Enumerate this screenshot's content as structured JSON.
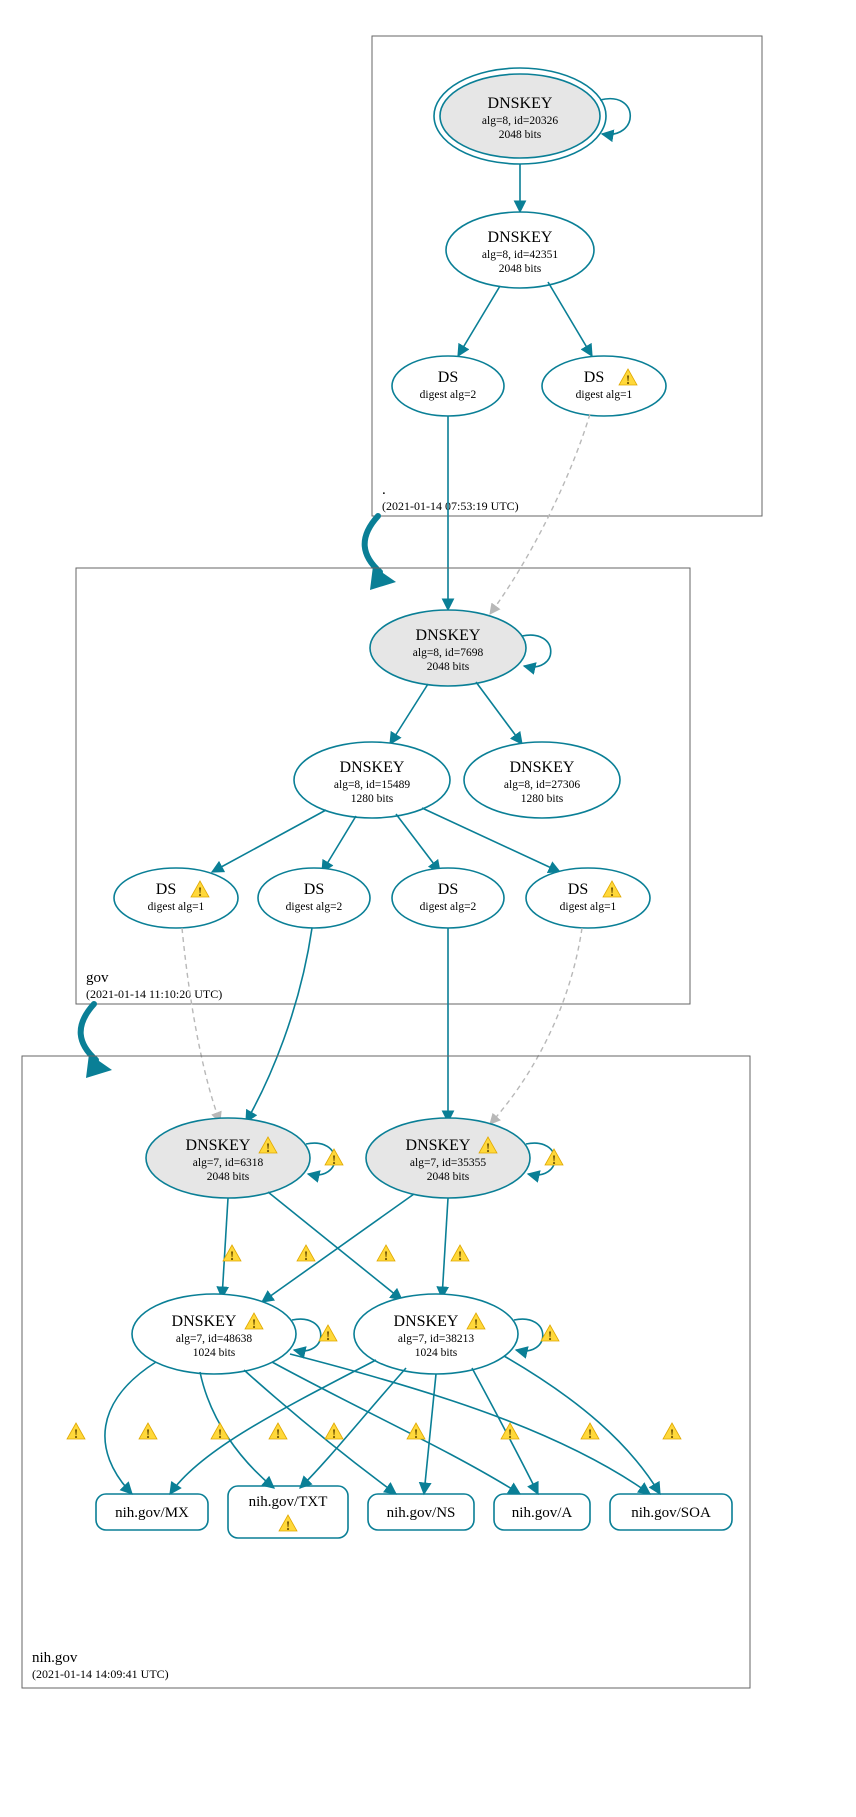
{
  "zones": {
    "root": {
      "name": ".",
      "timestamp": "(2021-01-14 07:53:19 UTC)"
    },
    "gov": {
      "name": "gov",
      "timestamp": "(2021-01-14 11:10:20 UTC)"
    },
    "nih": {
      "name": "nih.gov",
      "timestamp": "(2021-01-14 14:09:41 UTC)"
    }
  },
  "labels": {
    "dnskey": "DNSKEY",
    "ds": "DS",
    "digest1": "digest alg=1",
    "digest2": "digest alg=2"
  },
  "root_keys": {
    "ksk": {
      "line1": "alg=8, id=20326",
      "line2": "2048 bits"
    },
    "zsk": {
      "line1": "alg=8, id=42351",
      "line2": "2048 bits"
    }
  },
  "gov_keys": {
    "ksk": {
      "line1": "alg=8, id=7698",
      "line2": "2048 bits"
    },
    "zsk1": {
      "line1": "alg=8, id=15489",
      "line2": "1280 bits"
    },
    "zsk2": {
      "line1": "alg=8, id=27306",
      "line2": "1280 bits"
    }
  },
  "nih_keys": {
    "kskA": {
      "line1": "alg=7, id=6318",
      "line2": "2048 bits"
    },
    "kskB": {
      "line1": "alg=7, id=35355",
      "line2": "2048 bits"
    },
    "zskA": {
      "line1": "alg=7, id=48638",
      "line2": "1024 bits"
    },
    "zskB": {
      "line1": "alg=7, id=38213",
      "line2": "1024 bits"
    }
  },
  "rrsets": {
    "mx": "nih.gov/MX",
    "txt": "nih.gov/TXT",
    "ns": "nih.gov/NS",
    "a": "nih.gov/A",
    "soa": "nih.gov/SOA"
  }
}
